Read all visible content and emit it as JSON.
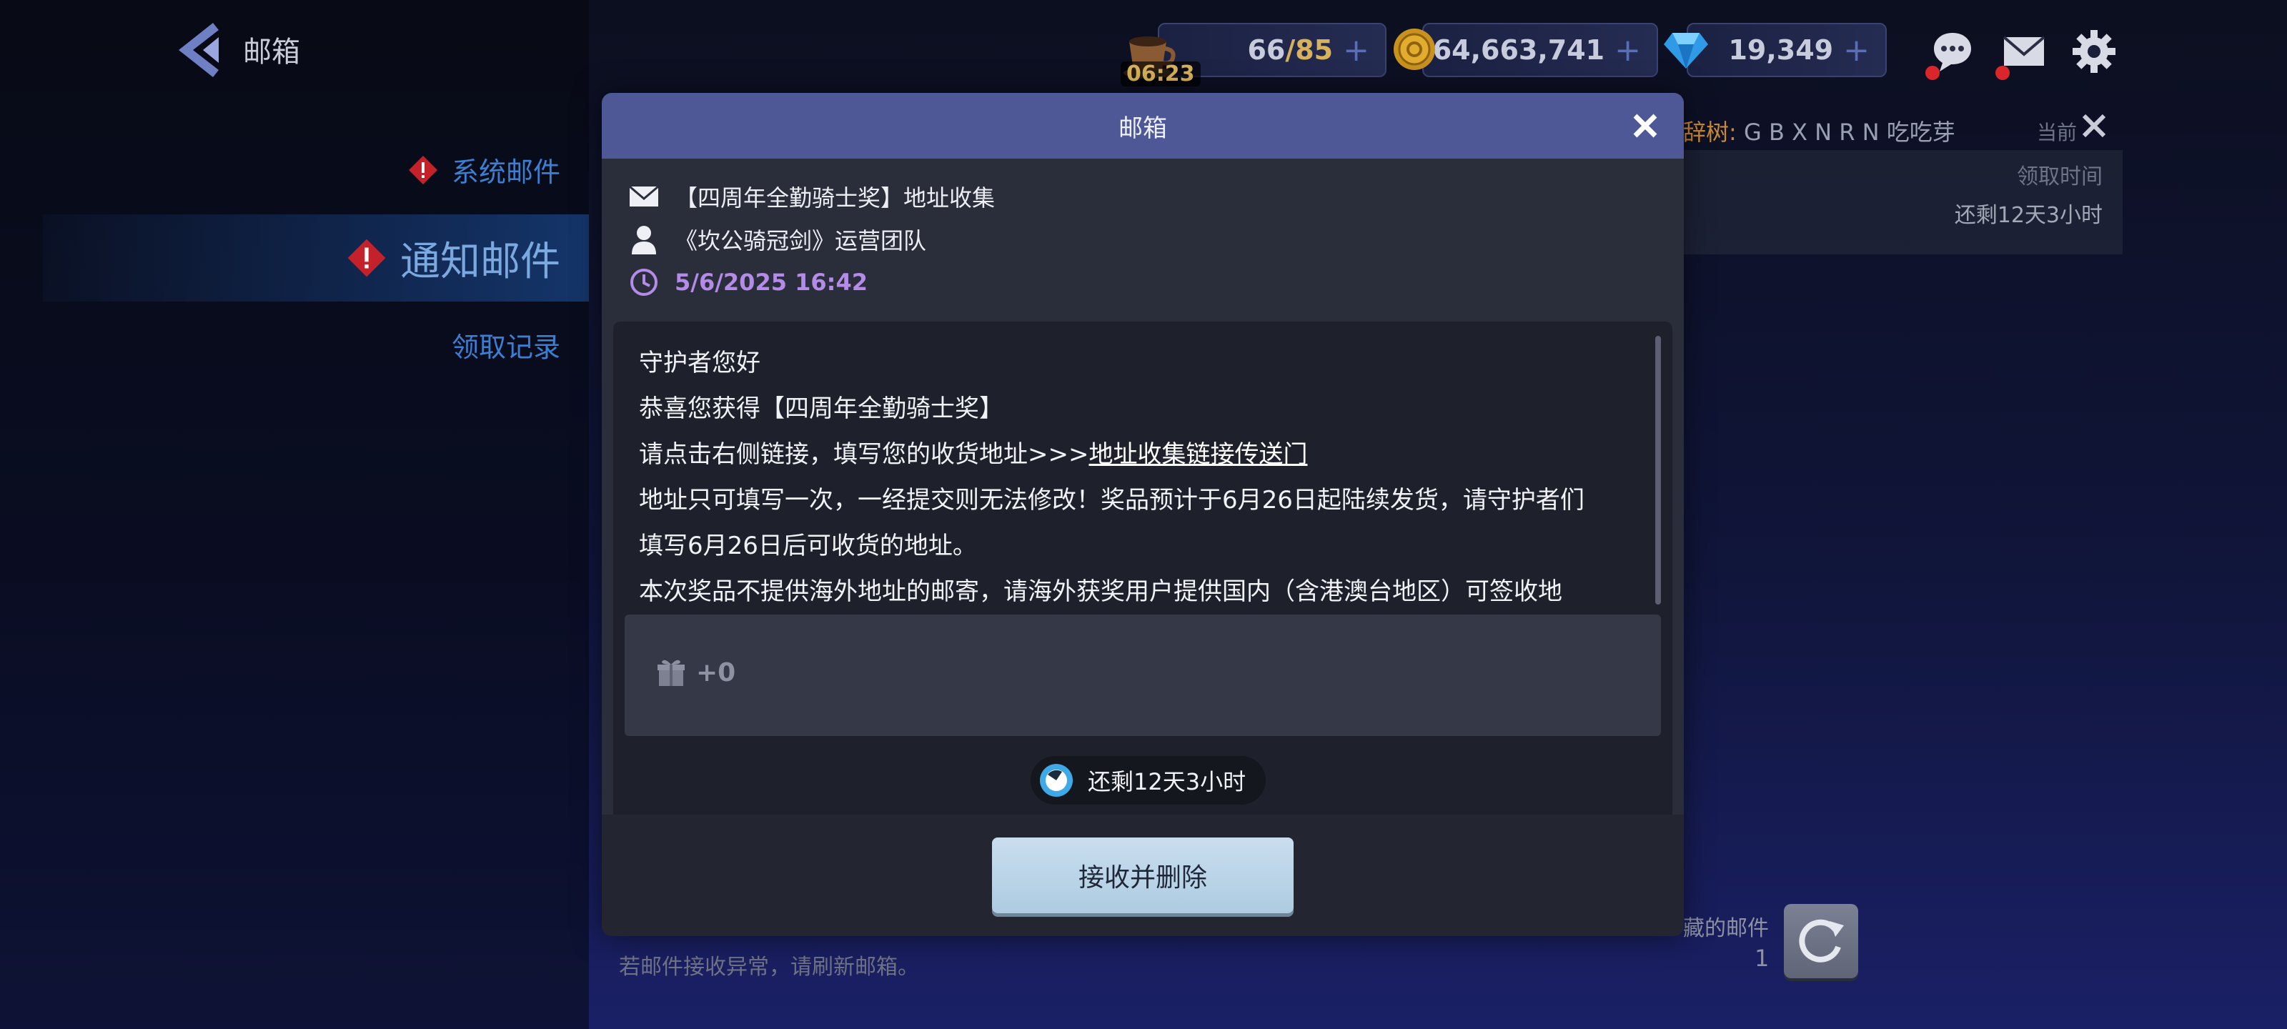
{
  "header": {
    "title": "邮箱"
  },
  "sidebar": {
    "items": [
      {
        "label": "系统邮件"
      },
      {
        "label": "通知邮件"
      },
      {
        "label": "领取记录"
      }
    ]
  },
  "resources": {
    "energy": {
      "current": "66",
      "max": "/85",
      "timer": "06:23",
      "icon": "coffee-cup-icon"
    },
    "coins": {
      "value": "64,663,741",
      "icon": "gold-coin-icon"
    },
    "gems": {
      "value": "19,349",
      "icon": "diamond-icon"
    },
    "plus": "+"
  },
  "background": {
    "filter_prefix": "辞树:",
    "filter_rest": " G B X N R N 吃吃芽",
    "current": "当前",
    "col_claim_time": "领取时间",
    "remaining": "还剩12天3小时",
    "mail_count_label": "藏的邮件",
    "mail_count": "1",
    "hint": "若邮件接收异常，请刷新邮箱。"
  },
  "modal": {
    "title": "邮箱",
    "subject": "【四周年全勤骑士奖】地址收集",
    "sender": "《坎公骑冠剑》运营团队",
    "date": "5/6/2025 16:42",
    "body": {
      "line1": "守护者您好",
      "line2": "恭喜您获得【四周年全勤骑士奖】",
      "line3_prefix": "请点击右侧链接，填写您的收货地址>>>",
      "line3_link": "地址收集链接传送门",
      "line4": "地址只可填写一次，一经提交则无法修改！奖品预计于6月26日起陆续发货，请守护者们",
      "line5": "填写6月26日后可收货的地址。",
      "line6": "本次奖品不提供海外地址的邮寄，请海外获奖用户提供国内（含港澳台地区）可签收地"
    },
    "attachment": "+0",
    "expires": "还剩12天3小时",
    "accept_button": "接收并删除"
  },
  "colors": {
    "modal_header": "#4e5896",
    "date": "#b58be8",
    "accept_button": "#c2d8ea",
    "sidebar_active": "#163c78",
    "badge_red": "#d9262b"
  }
}
